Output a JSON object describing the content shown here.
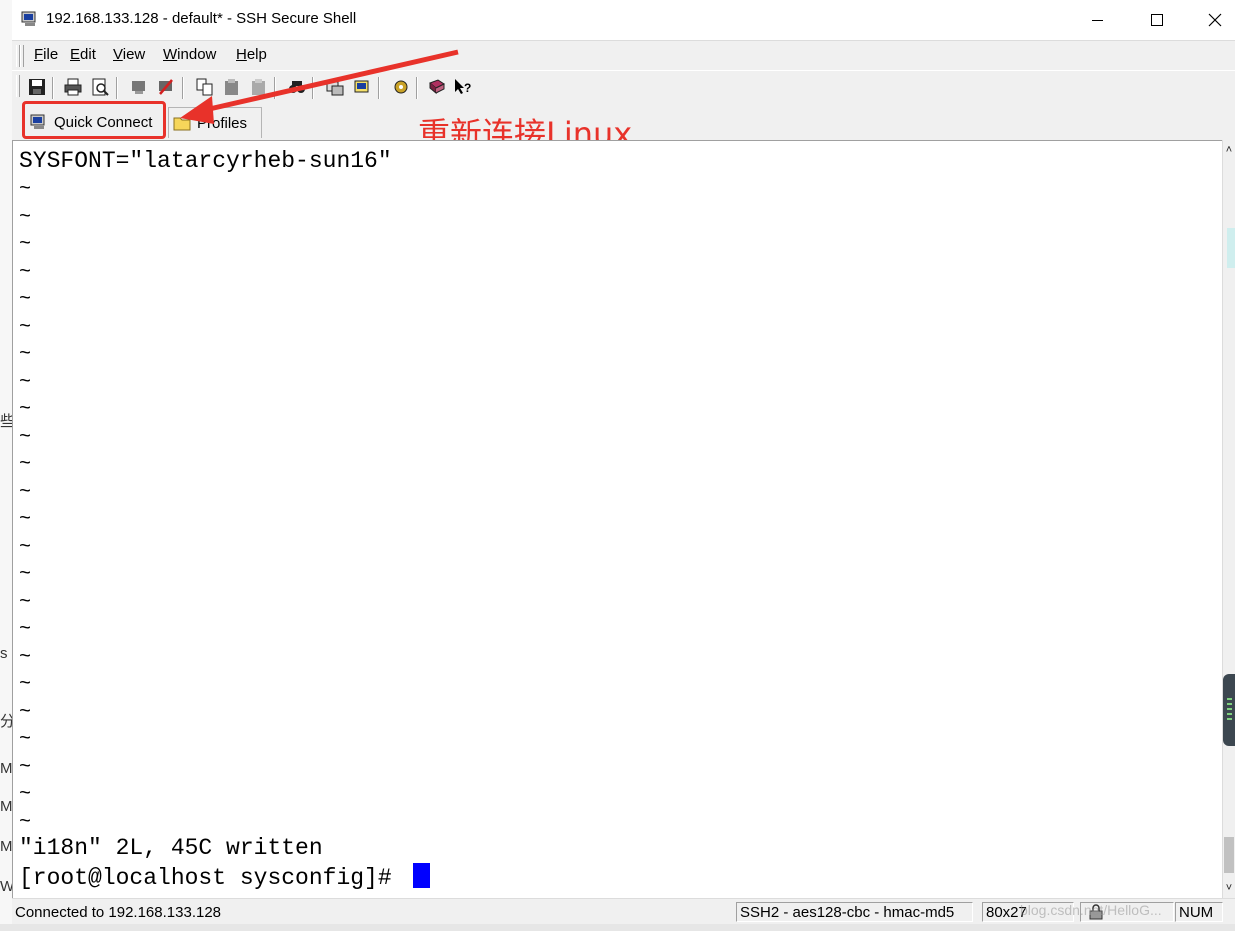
{
  "window": {
    "title": "192.168.133.128 - default* - SSH Secure Shell",
    "controls": {
      "minimize": "minimize",
      "maximize": "maximize",
      "close": "close"
    }
  },
  "menu": [
    {
      "label": "File",
      "accel": "F",
      "rest": "ile"
    },
    {
      "label": "Edit",
      "accel": "E",
      "rest": "dit"
    },
    {
      "label": "View",
      "accel": "V",
      "rest": "iew"
    },
    {
      "label": "Window",
      "accel": "W",
      "rest": "indow"
    },
    {
      "label": "Help",
      "accel": "H",
      "rest": "elp"
    }
  ],
  "toolbar_icons": [
    "save-icon",
    "print-icon",
    "print-preview-icon",
    "disconnect-icon",
    "reconnect-icon",
    "copy-icon",
    "paste-icon",
    "paste-disabled-icon",
    "find-icon",
    "file-transfer-icon",
    "new-terminal-icon",
    "settings-icon",
    "help-book-icon",
    "context-help-icon"
  ],
  "quickbar": {
    "quick_connect": "Quick Connect",
    "profiles": "Profiles"
  },
  "annotation": {
    "text": "重新连接Linux",
    "color": "#e8322a"
  },
  "terminal": {
    "first_line": "SYSFONT=\"latarcyrheb-sun16\"",
    "tilde": "~",
    "tilde_count": 24,
    "status_line": "\"i18n\" 2L, 45C written",
    "prompt": "[root@localhost sysconfig]# ",
    "cursor_color": "#0000ff"
  },
  "status": {
    "connection": "Connected to 192.168.133.128",
    "cipher": "SSH2 - aes128-cbc - hmac-md5",
    "size": "80x27",
    "num": "NUM"
  },
  "watermark": "blog.csdn.net/HelloG..."
}
